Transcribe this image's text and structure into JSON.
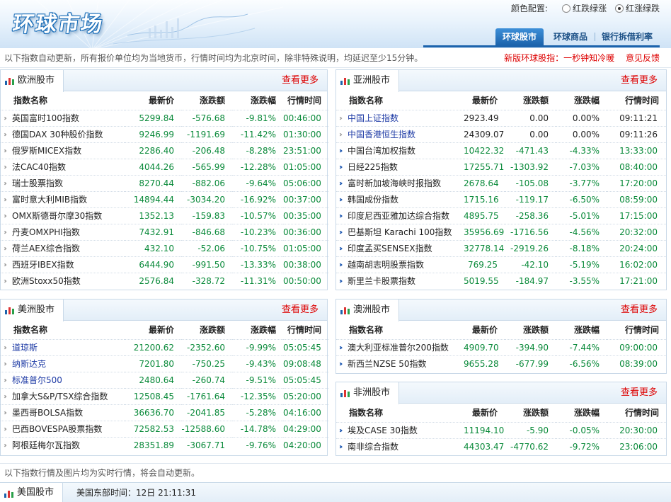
{
  "header": {
    "logo": "环球市场",
    "color_config": {
      "label": "颜色配置:",
      "options": [
        "红跌绿涨",
        "红涨绿跌"
      ],
      "selected": 1
    },
    "tabs": [
      "环球股市",
      "环球商品",
      "银行拆借利率"
    ],
    "active_tab": 0
  },
  "notice": {
    "text": "以下指数自动更新，所有报价单位均为当地货币，行情时间均为北京时间，除非特殊说明，均延迟至少15分钟。",
    "links": [
      "新版环球股指：一秒钟知冷暖",
      "意见反馈"
    ]
  },
  "colors": {
    "up_color": "#d00000",
    "down_color": "#0a8a3a",
    "accent": "#1c63ac",
    "link": "#1d3aa5"
  },
  "columns": [
    "指数名称",
    "最新价",
    "涨跌额",
    "涨跌幅",
    "行情时间"
  ],
  "more_label": "查看更多",
  "europe": {
    "title": "欧洲股市",
    "rows": [
      [
        "英国富时100指数",
        "5299.84",
        "-576.68",
        "-9.81%",
        "00:46:00"
      ],
      [
        "德国DAX 30种股价指数",
        "9246.99",
        "-1191.69",
        "-11.42%",
        "01:30:00"
      ],
      [
        "俄罗斯MICEX指数",
        "2286.40",
        "-206.48",
        "-8.28%",
        "23:51:00"
      ],
      [
        "法CAC40指数",
        "4044.26",
        "-565.99",
        "-12.28%",
        "01:05:00"
      ],
      [
        "瑞士股票指数",
        "8270.44",
        "-882.06",
        "-9.64%",
        "05:06:00"
      ],
      [
        "富时意大利MIB指数",
        "14894.44",
        "-3034.20",
        "-16.92%",
        "00:37:00"
      ],
      [
        "OMX斯德哥尔摩30指数",
        "1352.13",
        "-159.83",
        "-10.57%",
        "00:35:00"
      ],
      [
        "丹麦OMXPHI指数",
        "7432.91",
        "-846.68",
        "-10.23%",
        "00:36:00"
      ],
      [
        "荷兰AEX综合指数",
        "432.10",
        "-52.06",
        "-10.75%",
        "01:05:00"
      ],
      [
        "西班牙IBEX指数",
        "6444.90",
        "-991.50",
        "-13.33%",
        "00:38:00"
      ],
      [
        "欧洲Stoxx50指数",
        "2576.84",
        "-328.72",
        "-11.31%",
        "00:50:00"
      ]
    ]
  },
  "asia": {
    "title": "亚洲股市",
    "rows": [
      [
        "中国上证指数",
        "2923.49",
        "0.00",
        "0.00%",
        "09:11:21"
      ],
      [
        "中国香港恒生指数",
        "24309.07",
        "0.00",
        "0.00%",
        "09:11:26"
      ],
      [
        "中国台湾加权指数",
        "10422.32",
        "-471.43",
        "-4.33%",
        "13:33:00"
      ],
      [
        "日经225指数",
        "17255.71",
        "-1303.92",
        "-7.03%",
        "08:40:00"
      ],
      [
        "富时新加坡海峡时报指数",
        "2678.64",
        "-105.08",
        "-3.77%",
        "17:20:00"
      ],
      [
        "韩国成份指数",
        "1715.16",
        "-119.17",
        "-6.50%",
        "08:59:00"
      ],
      [
        "印度尼西亚雅加达综合指数",
        "4895.75",
        "-258.36",
        "-5.01%",
        "17:15:00"
      ],
      [
        "巴基斯坦 Karachi 100指数",
        "35956.69",
        "-1716.56",
        "-4.56%",
        "20:32:00"
      ],
      [
        "印度孟买SENSEX指数",
        "32778.14",
        "-2919.26",
        "-8.18%",
        "20:24:00"
      ],
      [
        "越南胡志明股票指数",
        "769.25",
        "-42.10",
        "-5.19%",
        "16:02:00"
      ],
      [
        "斯里兰卡股票指数",
        "5019.55",
        "-184.97",
        "-3.55%",
        "17:21:00"
      ]
    ]
  },
  "america": {
    "title": "美洲股市",
    "rows": [
      [
        "道琼斯",
        "21200.62",
        "-2352.60",
        "-9.99%",
        "05:05:45"
      ],
      [
        "纳斯达克",
        "7201.80",
        "-750.25",
        "-9.43%",
        "09:08:48"
      ],
      [
        "标准普尔500",
        "2480.64",
        "-260.74",
        "-9.51%",
        "05:05:45"
      ],
      [
        "加拿大S&P/TSX综合指数",
        "12508.45",
        "-1761.64",
        "-12.35%",
        "05:20:00"
      ],
      [
        "墨西哥BOLSA指数",
        "36636.70",
        "-2041.85",
        "-5.28%",
        "04:16:00"
      ],
      [
        "巴西BOVESPA股票指数",
        "72582.53",
        "-12588.60",
        "-14.78%",
        "04:29:00"
      ],
      [
        "阿根廷梅尔瓦指数",
        "28351.89",
        "-3067.71",
        "-9.76%",
        "04:20:00"
      ]
    ]
  },
  "oceania": {
    "title": "澳洲股市",
    "rows": [
      [
        "澳大利亚标准普尔200指数",
        "4909.70",
        "-394.90",
        "-7.44%",
        "09:00:00"
      ],
      [
        "新西兰NZSE 50指数",
        "9655.28",
        "-677.99",
        "-6.56%",
        "08:39:00"
      ]
    ]
  },
  "africa": {
    "title": "非洲股市",
    "rows": [
      [
        "埃及CASE 30指数",
        "11194.10",
        "-5.90",
        "-0.05%",
        "20:30:00"
      ],
      [
        "南非综合指数",
        "44303.47",
        "-4770.62",
        "-9.72%",
        "23:06:00"
      ]
    ]
  },
  "footer": {
    "notice": "以下指数行情及图片均为实时行情，将会自动更新。",
    "us_title": "美国股市",
    "us_time": "美国东部时间：12日 21:11:31"
  }
}
